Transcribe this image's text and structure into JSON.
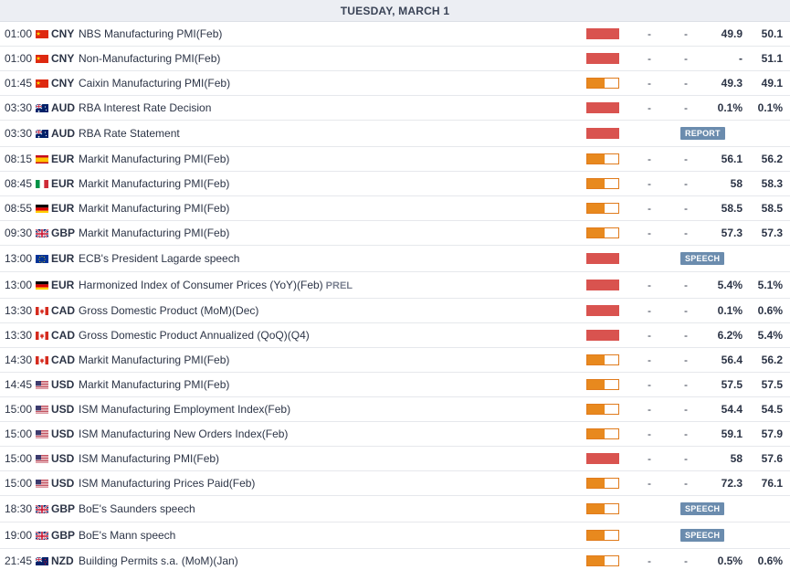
{
  "header": {
    "date_label": "TUESDAY, MARCH 1"
  },
  "colors": {
    "high_volatility": "#d9534f",
    "medium_volatility": "#e8891e",
    "badge": "#6b8cae",
    "header_bg": "#eceef3"
  },
  "rows": [
    {
      "time": "01:00",
      "flag": "cn",
      "currency": "CNY",
      "event": "NBS Manufacturing PMI(Feb)",
      "tag": "",
      "volatility": "high",
      "actual": "-",
      "deviation": "-",
      "consensus": "49.9",
      "previous": "50.1",
      "badge": ""
    },
    {
      "time": "01:00",
      "flag": "cn",
      "currency": "CNY",
      "event": "Non-Manufacturing PMI(Feb)",
      "tag": "",
      "volatility": "high",
      "actual": "-",
      "deviation": "-",
      "consensus": "-",
      "previous": "51.1",
      "badge": ""
    },
    {
      "time": "01:45",
      "flag": "cn",
      "currency": "CNY",
      "event": "Caixin Manufacturing PMI(Feb)",
      "tag": "",
      "volatility": "medium",
      "actual": "-",
      "deviation": "-",
      "consensus": "49.3",
      "previous": "49.1",
      "badge": ""
    },
    {
      "time": "03:30",
      "flag": "au",
      "currency": "AUD",
      "event": "RBA Interest Rate Decision",
      "tag": "",
      "volatility": "high",
      "actual": "-",
      "deviation": "-",
      "consensus": "0.1%",
      "previous": "0.1%",
      "badge": ""
    },
    {
      "time": "03:30",
      "flag": "au",
      "currency": "AUD",
      "event": "RBA Rate Statement",
      "tag": "",
      "volatility": "high",
      "actual": "",
      "deviation": "",
      "consensus": "",
      "previous": "",
      "badge": "REPORT"
    },
    {
      "time": "08:15",
      "flag": "es",
      "currency": "EUR",
      "event": "Markit Manufacturing PMI(Feb)",
      "tag": "",
      "volatility": "medium",
      "actual": "-",
      "deviation": "-",
      "consensus": "56.1",
      "previous": "56.2",
      "badge": ""
    },
    {
      "time": "08:45",
      "flag": "it",
      "currency": "EUR",
      "event": "Markit Manufacturing PMI(Feb)",
      "tag": "",
      "volatility": "medium",
      "actual": "-",
      "deviation": "-",
      "consensus": "58",
      "previous": "58.3",
      "badge": ""
    },
    {
      "time": "08:55",
      "flag": "de",
      "currency": "EUR",
      "event": "Markit Manufacturing PMI(Feb)",
      "tag": "",
      "volatility": "medium",
      "actual": "-",
      "deviation": "-",
      "consensus": "58.5",
      "previous": "58.5",
      "badge": ""
    },
    {
      "time": "09:30",
      "flag": "gb",
      "currency": "GBP",
      "event": "Markit Manufacturing PMI(Feb)",
      "tag": "",
      "volatility": "medium",
      "actual": "-",
      "deviation": "-",
      "consensus": "57.3",
      "previous": "57.3",
      "badge": ""
    },
    {
      "time": "13:00",
      "flag": "eu",
      "currency": "EUR",
      "event": "ECB's President Lagarde speech",
      "tag": "",
      "volatility": "high",
      "actual": "",
      "deviation": "",
      "consensus": "",
      "previous": "",
      "badge": "SPEECH"
    },
    {
      "time": "13:00",
      "flag": "de",
      "currency": "EUR",
      "event": "Harmonized Index of Consumer Prices (YoY)(Feb)",
      "tag": "PREL",
      "volatility": "high",
      "actual": "-",
      "deviation": "-",
      "consensus": "5.4%",
      "previous": "5.1%",
      "badge": ""
    },
    {
      "time": "13:30",
      "flag": "ca",
      "currency": "CAD",
      "event": "Gross Domestic Product (MoM)(Dec)",
      "tag": "",
      "volatility": "high",
      "actual": "-",
      "deviation": "-",
      "consensus": "0.1%",
      "previous": "0.6%",
      "badge": ""
    },
    {
      "time": "13:30",
      "flag": "ca",
      "currency": "CAD",
      "event": "Gross Domestic Product Annualized (QoQ)(Q4)",
      "tag": "",
      "volatility": "high",
      "actual": "-",
      "deviation": "-",
      "consensus": "6.2%",
      "previous": "5.4%",
      "badge": ""
    },
    {
      "time": "14:30",
      "flag": "ca",
      "currency": "CAD",
      "event": "Markit Manufacturing PMI(Feb)",
      "tag": "",
      "volatility": "medium",
      "actual": "-",
      "deviation": "-",
      "consensus": "56.4",
      "previous": "56.2",
      "badge": ""
    },
    {
      "time": "14:45",
      "flag": "us",
      "currency": "USD",
      "event": "Markit Manufacturing PMI(Feb)",
      "tag": "",
      "volatility": "medium",
      "actual": "-",
      "deviation": "-",
      "consensus": "57.5",
      "previous": "57.5",
      "badge": ""
    },
    {
      "time": "15:00",
      "flag": "us",
      "currency": "USD",
      "event": "ISM Manufacturing Employment Index(Feb)",
      "tag": "",
      "volatility": "medium",
      "actual": "-",
      "deviation": "-",
      "consensus": "54.4",
      "previous": "54.5",
      "badge": ""
    },
    {
      "time": "15:00",
      "flag": "us",
      "currency": "USD",
      "event": "ISM Manufacturing New Orders Index(Feb)",
      "tag": "",
      "volatility": "medium",
      "actual": "-",
      "deviation": "-",
      "consensus": "59.1",
      "previous": "57.9",
      "badge": ""
    },
    {
      "time": "15:00",
      "flag": "us",
      "currency": "USD",
      "event": "ISM Manufacturing PMI(Feb)",
      "tag": "",
      "volatility": "high",
      "actual": "-",
      "deviation": "-",
      "consensus": "58",
      "previous": "57.6",
      "badge": ""
    },
    {
      "time": "15:00",
      "flag": "us",
      "currency": "USD",
      "event": "ISM Manufacturing Prices Paid(Feb)",
      "tag": "",
      "volatility": "medium",
      "actual": "-",
      "deviation": "-",
      "consensus": "72.3",
      "previous": "76.1",
      "badge": ""
    },
    {
      "time": "18:30",
      "flag": "gb",
      "currency": "GBP",
      "event": "BoE's Saunders speech",
      "tag": "",
      "volatility": "medium",
      "actual": "",
      "deviation": "",
      "consensus": "",
      "previous": "",
      "badge": "SPEECH"
    },
    {
      "time": "19:00",
      "flag": "gb",
      "currency": "GBP",
      "event": "BoE's Mann speech",
      "tag": "",
      "volatility": "medium",
      "actual": "",
      "deviation": "",
      "consensus": "",
      "previous": "",
      "badge": "SPEECH"
    },
    {
      "time": "21:45",
      "flag": "nz",
      "currency": "NZD",
      "event": "Building Permits s.a. (MoM)(Jan)",
      "tag": "",
      "volatility": "medium",
      "actual": "-",
      "deviation": "-",
      "consensus": "0.5%",
      "previous": "0.6%",
      "badge": ""
    }
  ]
}
